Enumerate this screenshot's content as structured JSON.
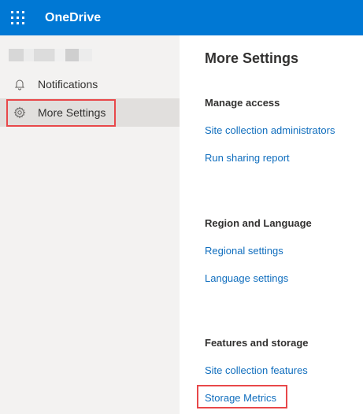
{
  "header": {
    "app_title": "OneDrive"
  },
  "sidebar": {
    "items": [
      {
        "label": "Notifications",
        "icon": "bell-icon"
      },
      {
        "label": "More Settings",
        "icon": "gear-icon"
      }
    ]
  },
  "main": {
    "title": "More Settings",
    "sections": [
      {
        "heading": "Manage access",
        "links": [
          "Site collection administrators",
          "Run sharing report"
        ]
      },
      {
        "heading": "Region and Language",
        "links": [
          "Regional settings",
          "Language settings"
        ]
      },
      {
        "heading": "Features and storage",
        "links": [
          "Site collection features",
          "Storage Metrics"
        ]
      }
    ]
  },
  "colors": {
    "brand": "#0078d4",
    "link": "#106ebe",
    "highlight": "#e8484a",
    "sidebar_bg": "#f3f2f1",
    "selected_bg": "#e1dfdd"
  }
}
